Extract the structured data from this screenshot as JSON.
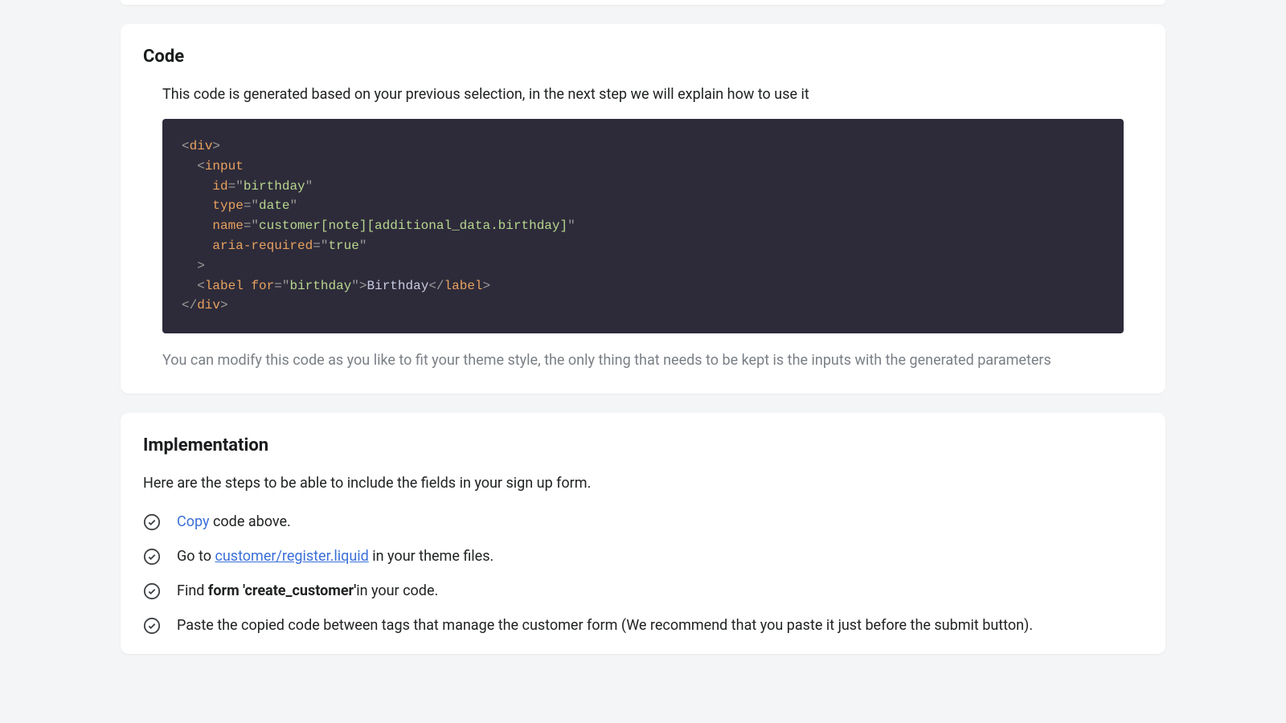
{
  "codeSection": {
    "title": "Code",
    "intro": "This code is generated based on your previous selection, in the next step we will explain how to use it",
    "note": "You can modify this code as you like to fit your theme style, the only thing that needs to be kept is the inputs with the generated parameters",
    "snippet": {
      "tag_div": "div",
      "tag_input": "input",
      "attr_id": "id",
      "val_id": "birthday",
      "attr_type": "type",
      "val_type": "date",
      "attr_name": "name",
      "val_name": "customer[note][additional_data.birthday]",
      "attr_aria": "aria-required",
      "val_aria": "true",
      "tag_label": "label",
      "attr_for": "for",
      "val_for": "birthday",
      "label_text": "Birthday"
    }
  },
  "implSection": {
    "title": "Implementation",
    "intro": "Here are the steps to be able to include the fields in your sign up form.",
    "steps": {
      "s1_copy": "Copy",
      "s1_rest": " code above.",
      "s2_pre": "Go to ",
      "s2_link": "customer/register.liquid",
      "s2_post": " in your theme files.",
      "s3_pre": "Find ",
      "s3_bold": "form 'create_customer'",
      "s3_post": "in your code.",
      "s4": "Paste the copied code between tags that manage the customer form (We recommend that you paste it just before the submit button)."
    }
  }
}
